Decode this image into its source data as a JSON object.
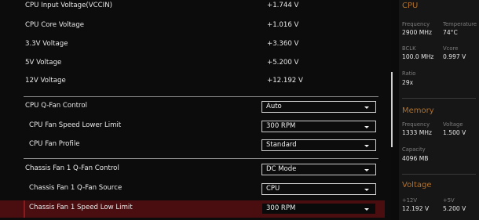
{
  "voltages": [
    {
      "label": "CPU Input Voltage(VCCIN)",
      "value": "+1.744 V"
    },
    {
      "label": "CPU Core Voltage",
      "value": "+1.016 V"
    },
    {
      "label": "3.3V Voltage",
      "value": "+3.360 V"
    },
    {
      "label": "5V Voltage",
      "value": "+5.200 V"
    },
    {
      "label": "12V Voltage",
      "value": "+12.192 V"
    }
  ],
  "settings": [
    {
      "label": "CPU Q-Fan Control",
      "value": "Auto"
    },
    {
      "label": "CPU Fan Speed Lower Limit",
      "value": "300 RPM"
    },
    {
      "label": "CPU Fan Profile",
      "value": "Standard"
    },
    {
      "label": "Chassis Fan 1 Q-Fan Control",
      "value": "DC Mode"
    },
    {
      "label": "Chassis Fan 1 Q-Fan Source",
      "value": "CPU"
    },
    {
      "label": "Chassis Fan 1 Speed Low Limit",
      "value": "300 RPM"
    }
  ],
  "monitor": {
    "cpu": {
      "title": "CPU",
      "frequency_label": "Frequency",
      "frequency_value": "2900 MHz",
      "temperature_label": "Temperature",
      "temperature_value": "74°C",
      "bclk_label": "BCLK",
      "bclk_value": "100.0 MHz",
      "vcore_label": "Vcore",
      "vcore_value": "0.997 V",
      "ratio_label": "Ratio",
      "ratio_value": "29x"
    },
    "memory": {
      "title": "Memory",
      "frequency_label": "Frequency",
      "frequency_value": "1333 MHz",
      "voltage_label": "Voltage",
      "voltage_value": "1.500 V",
      "capacity_label": "Capacity",
      "capacity_value": "4096 MB"
    },
    "voltage": {
      "title": "Voltage",
      "v12_label": "+12V",
      "v12_value": "12.192 V",
      "v5_label": "+5V",
      "v5_value": "5.200 V"
    }
  }
}
